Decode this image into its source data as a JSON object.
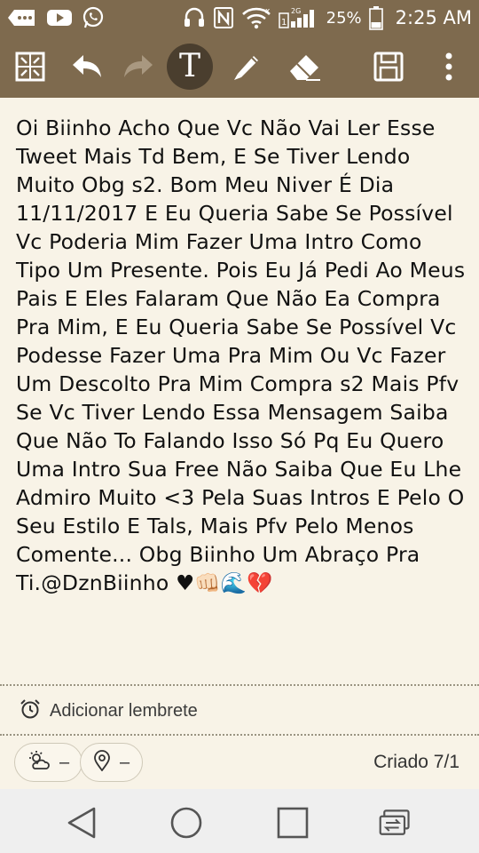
{
  "status_bar": {
    "battery": "25%",
    "time": "2:25 AM",
    "network": "2G",
    "icons": [
      "message-icon",
      "youtube-icon",
      "whatsapp-icon",
      "headset-icon",
      "nfc-icon",
      "wifi-icon",
      "sim-signal-icon",
      "battery-icon"
    ]
  },
  "toolbar": {
    "text_tool_label": "T",
    "icons": [
      "grid-layout-icon",
      "undo-icon",
      "redo-icon",
      "text-tool-icon",
      "pen-icon",
      "eraser-icon",
      "save-icon",
      "more-vert-icon"
    ]
  },
  "note": {
    "body": "Oi Biinho Acho Que Vc Não Vai Ler Esse Tweet Mais Td Bem, E Se Tiver Lendo Muito Obg s2. Bom Meu Niver É Dia 11/11/2017 E Eu Queria Sabe Se Possível Vc Poderia Mim Fazer Uma Intro Como Tipo Um Presente. Pois Eu Já Pedi Ao Meus Pais E Eles Falaram Que Não Ea Compra Pra Mim, E Eu Queria Sabe Se Possível Vc Podesse Fazer Uma Pra Mim Ou Vc Fazer Um Descolto Pra Mim Compra s2 Mais Pfv Se Vc Tiver Lendo Essa Mensagem Saiba Que Não To Falando Isso Só Pq Eu Quero Uma Intro Sua Free Não Saiba Que Eu Lhe Admiro Muito <3 Pela Suas Intros E Pelo O Seu Estilo E Tals, Mais Pfv Pelo Menos Comente... Obg Biinho Um Abraço Pra Ti.@DznBiinho ♥👊🏻🌊💔"
  },
  "reminder": {
    "label": "Adicionar lembrete"
  },
  "footer": {
    "weather_value": "–",
    "location_value": "–",
    "created": "Criado 7/1"
  },
  "navbar": {
    "icons": [
      "back-icon",
      "home-icon",
      "recents-icon",
      "switch-app-icon"
    ]
  },
  "colors": {
    "toolbar_bg": "#7e6a4e",
    "note_bg": "#f8f3e7",
    "active_tool_bg": "#4a3e2e",
    "nav_bg": "#efefef"
  }
}
